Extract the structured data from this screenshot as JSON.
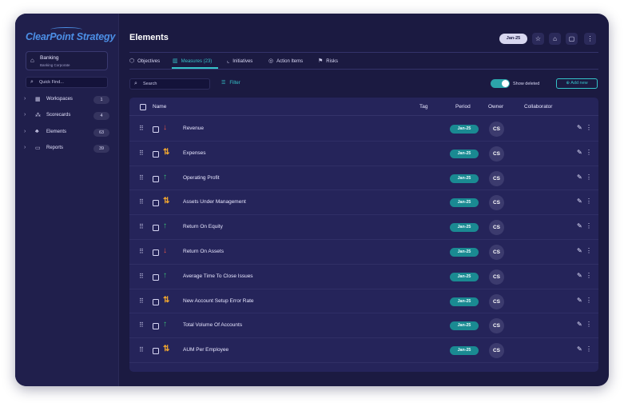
{
  "sidebar": {
    "logo": "ClearPoint Strategy",
    "org": {
      "name": "Banking",
      "subtitle": "Banking Corporate"
    },
    "quick_find_placeholder": "Quick Find...",
    "items": [
      {
        "label": "Workspaces",
        "count": "1",
        "icon": "grid-icon"
      },
      {
        "label": "Scorecards",
        "count": "4",
        "icon": "hierarchy-icon"
      },
      {
        "label": "Elements",
        "count": "63",
        "icon": "org-chart-icon"
      },
      {
        "label": "Reports",
        "count": "39",
        "icon": "report-icon"
      }
    ]
  },
  "header": {
    "title": "Elements",
    "period": "Jan-25",
    "icons": [
      "star-icon",
      "home-icon",
      "comment-icon",
      "more-vertical-icon"
    ]
  },
  "tabs": [
    {
      "label": "Objectives",
      "icon": "cube-icon",
      "active": false
    },
    {
      "label": "Measures (23)",
      "icon": "chart-icon",
      "active": true
    },
    {
      "label": "Initiatives",
      "icon": "line-chart-icon",
      "active": false
    },
    {
      "label": "Action Items",
      "icon": "check-circle-icon",
      "active": false
    },
    {
      "label": "Risks",
      "icon": "flag-icon",
      "active": false
    }
  ],
  "toolbar": {
    "search_placeholder": "Search",
    "filter_label": "Filter",
    "show_deleted_label": "Show deleted",
    "show_deleted_on": true,
    "add_new_label": "Add new"
  },
  "table": {
    "columns": [
      "Name",
      "Tag",
      "Period",
      "Owner",
      "Collaborator"
    ],
    "rows": [
      {
        "name": "Revenue",
        "trend": "down",
        "period": "Jan-25",
        "owner": "CS"
      },
      {
        "name": "Expenses",
        "trend": "mixed",
        "period": "Jan-25",
        "owner": "CS"
      },
      {
        "name": "Operating Profit",
        "trend": "up",
        "period": "Jan-25",
        "owner": "CS"
      },
      {
        "name": "Assets Under Management",
        "trend": "mixed",
        "period": "Jan-25",
        "owner": "CS"
      },
      {
        "name": "Return On Equity",
        "trend": "up",
        "period": "Jan-25",
        "owner": "CS"
      },
      {
        "name": "Return On Assets",
        "trend": "down",
        "period": "Jan-25",
        "owner": "CS"
      },
      {
        "name": "Average Time To Close Issues",
        "trend": "up",
        "period": "Jan-25",
        "owner": "CS"
      },
      {
        "name": "New Account Setup Error Rate",
        "trend": "mixed",
        "period": "Jan-25",
        "owner": "CS"
      },
      {
        "name": "Total Volume Of Accounts",
        "trend": "up",
        "period": "Jan-25",
        "owner": "CS"
      },
      {
        "name": "AUM Per Employee",
        "trend": "mixed",
        "period": "Jan-25",
        "owner": "CS"
      }
    ]
  },
  "colors": {
    "background": "#1b1a41",
    "accent": "#35c3c9",
    "period_pill": "#1a8a92",
    "trend_up": "#3bbf74",
    "trend_down": "#e2554a",
    "trend_mixed": "#f0a630"
  }
}
